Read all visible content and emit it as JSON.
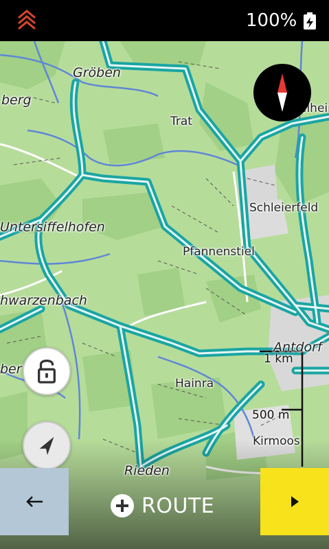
{
  "status": {
    "battery": "100%",
    "logo_icon": "chevron-stack-icon",
    "battery_icon": "battery-charging-icon"
  },
  "map": {
    "places": [
      {
        "name": "Gröben",
        "style": "italic"
      },
      {
        "name": "berg",
        "style": "italic"
      },
      {
        "name": "Trat",
        "style": "regular"
      },
      {
        "name": "elheim",
        "style": "regular"
      },
      {
        "name": "Schleierfeld",
        "style": "regular"
      },
      {
        "name": "Untersiffelhofen",
        "style": "italic"
      },
      {
        "name": "Pfannenstiel",
        "style": "regular"
      },
      {
        "name": "hwarzenbach",
        "style": "italic"
      },
      {
        "name": "Antdorf",
        "style": "italic"
      },
      {
        "name": "ber",
        "style": "italic"
      },
      {
        "name": "Hainra",
        "style": "regular"
      },
      {
        "name": "Kirmoos",
        "style": "regular"
      },
      {
        "name": "Rieden",
        "style": "italic"
      }
    ],
    "scale": {
      "large": "1 km",
      "small": "500 m"
    },
    "compass_icon": "compass-icon"
  },
  "controls": {
    "lock_icon": "unlock-icon",
    "locate_icon": "locate-arrow-icon",
    "back_icon": "arrow-left-icon",
    "route_label": "ROUTE",
    "route_icon": "plus-circle-icon",
    "next_icon": "play-icon"
  },
  "colors": {
    "route": "#1aa5a3",
    "map_green": "#b6dc9a",
    "forest": "#9fcf85",
    "next_button": "#f7e21b",
    "back_button": "#b3c7d6",
    "compass_north": "#e53935"
  }
}
